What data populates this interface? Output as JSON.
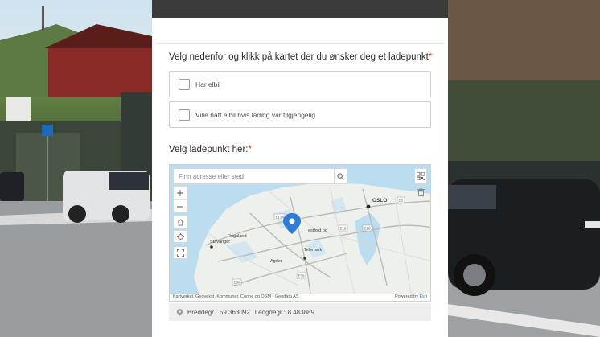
{
  "form": {
    "question1": {
      "label": "Velg nedenfor og klikk på kartet der du ønsker deg et ladepunkt",
      "required": "*"
    },
    "options": [
      {
        "label": "Har elbil"
      },
      {
        "label": "Ville hatt elbil hvis lading var tilgjengelig"
      }
    ],
    "question2": {
      "label": "Velg ladepunkt her:",
      "required": "*"
    }
  },
  "map": {
    "search_placeholder": "Finn adresse eller sted",
    "places": [
      {
        "name": "OSLO"
      },
      {
        "name": "Rogaland"
      },
      {
        "name": "Stavanger"
      },
      {
        "name": "Agder"
      },
      {
        "name": "estfold og"
      },
      {
        "name": "Telemark"
      }
    ],
    "road_shields": [
      "E134",
      "E18",
      "E39",
      "E18",
      "E6",
      "E39"
    ],
    "attribution": "Kartverket, Geovekst, Kommuner, Corine og OSM - Geodata AS",
    "powered_by": "Powered by",
    "powered_brand": "Esri",
    "coordinates": {
      "lat_label": "Breddegr.:",
      "lat_value": "59.363092",
      "lon_label": "Lengdegr.:",
      "lon_value": "8.483889"
    }
  },
  "colors": {
    "header": "#3b3b3b",
    "required": "#d83020",
    "water": "#bcdcef",
    "land": "#eef0ec",
    "pin": "#2e7cd6"
  }
}
